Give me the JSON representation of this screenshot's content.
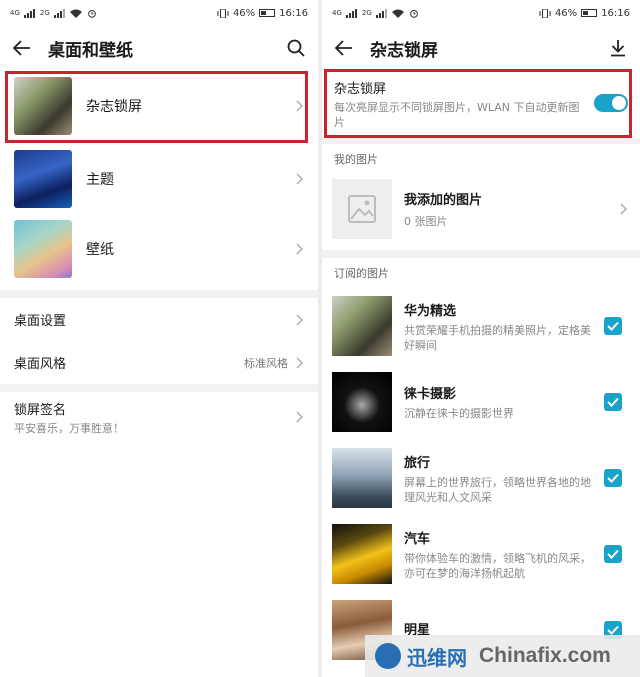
{
  "status": {
    "carrier1": "4G",
    "carrier2": "2G",
    "battery": "46%",
    "time": "16:16",
    "battery_level": 0.46
  },
  "left": {
    "title": "桌面和壁纸",
    "items": [
      {
        "label": "杂志锁屏",
        "thumb": "magazine-lockscreen-thumbnail"
      },
      {
        "label": "主题",
        "thumb": "themes-thumbnail"
      },
      {
        "label": "壁纸",
        "thumb": "wallpaper-thumbnail"
      }
    ],
    "desktop_settings": "桌面设置",
    "desktop_style": {
      "label": "桌面风格",
      "value": "标准风格"
    },
    "lock_signature": {
      "label": "锁屏签名",
      "value": "平安喜乐，万事胜意！"
    }
  },
  "right": {
    "title": "杂志锁屏",
    "toggle": {
      "label": "杂志锁屏",
      "desc": "每次亮屏显示不同锁屏图片，WLAN 下自动更新图片",
      "on": true
    },
    "my_pictures": {
      "section": "我的图片",
      "title": "我添加的图片",
      "count": "0 张图片"
    },
    "subscribed": {
      "section": "订阅的图片",
      "items": [
        {
          "name": "华为精选",
          "desc": "共赏荣耀手机拍摄的精美照片，定格美好瞬间",
          "checked": true
        },
        {
          "name": "徕卡摄影",
          "desc": "沉静在徕卡的摄影世界",
          "checked": true
        },
        {
          "name": "旅行",
          "desc": "屏幕上的世界旅行，领略世界各地的地理风光和人文风采",
          "checked": true
        },
        {
          "name": "汽车",
          "desc": "带你体验车的激情，领略飞机的风采，亦可在梦的海洋扬帆起航",
          "checked": true
        },
        {
          "name": "明星",
          "desc": "",
          "checked": true
        }
      ]
    }
  },
  "watermark": {
    "cn": "迅维网",
    "en": "Chinafix.com"
  },
  "colors": {
    "accent": "#1aa3c9",
    "highlight": "#c8242e"
  }
}
